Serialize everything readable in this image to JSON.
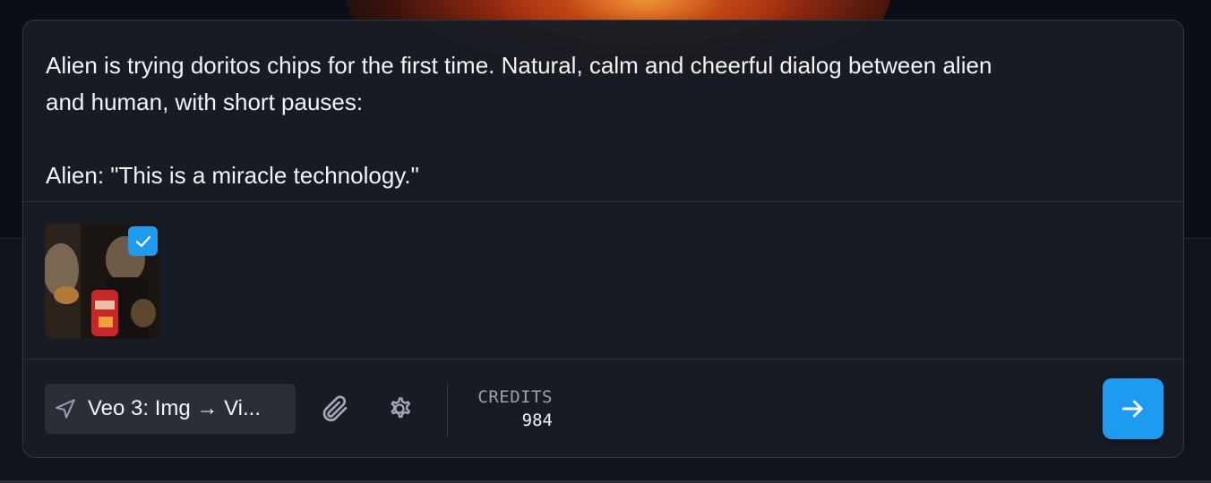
{
  "prompt": {
    "text": "Alien is trying doritos chips for the first time. Natural, calm and cheerful dialog between alien\nand human, with short pauses:\n\nAlien: \"This is a miracle technology.\""
  },
  "attachments": [
    {
      "selected": true,
      "icon": "check-icon"
    }
  ],
  "toolbar": {
    "model_label": "Veo 3: Img → Vi...",
    "model_icon": "send-plane-icon",
    "attach_icon": "paperclip-icon",
    "settings_icon": "gear-icon",
    "credits_label": "CREDITS",
    "credits_value": "984",
    "send_icon": "arrow-right-icon"
  },
  "colors": {
    "accent": "#1d9bf0",
    "panel": "#181c24",
    "text": "#f3f4f6",
    "muted": "#9aa1ac"
  }
}
